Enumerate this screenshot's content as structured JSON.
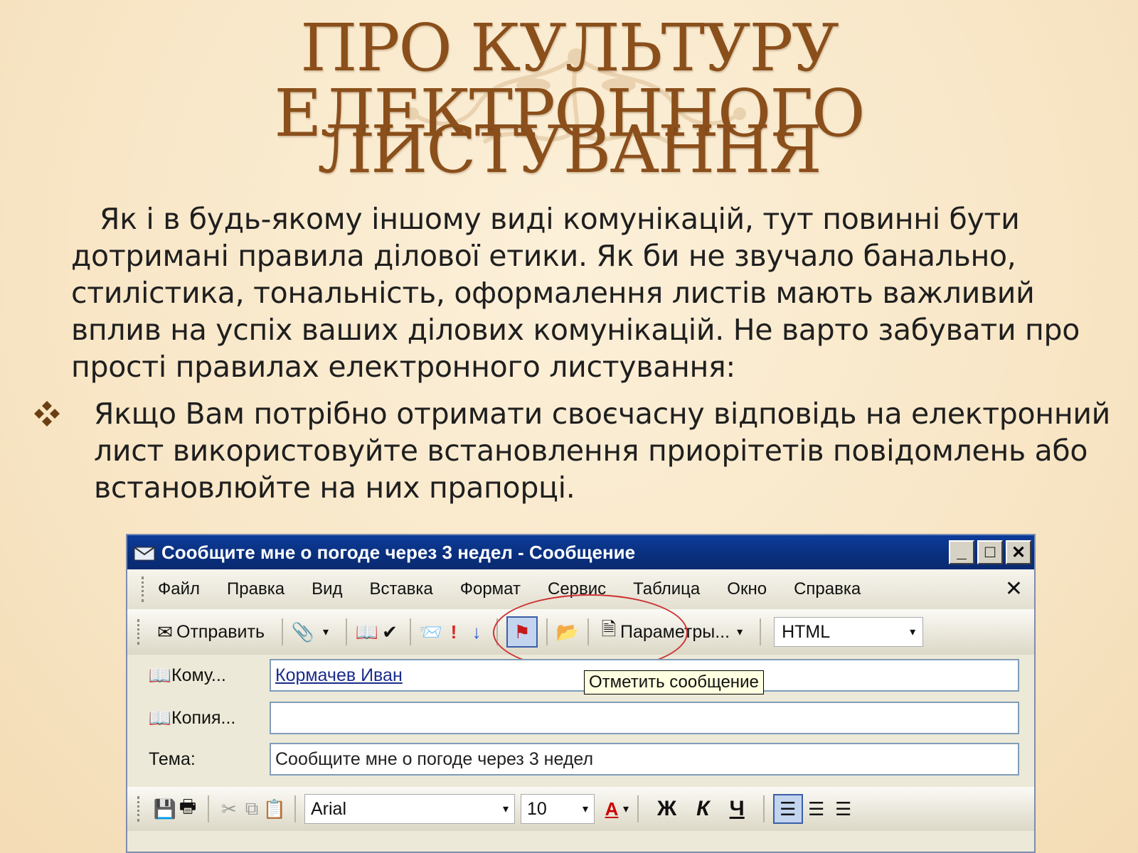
{
  "slide": {
    "title_line1": "ПРО КУЛЬТУРУ ЕЛЕКТРОННОГО",
    "title_line2": "ЛИСТУВАННЯ",
    "paragraph": "Як і в будь-якому іншому виді комунікацій, тут повинні бути дотримані правила ділової етики. Як би не звучало банально, стилістика, тональність, оформалення листів мають важливий вплив на успіх ваших ділових комунікацій. Не варто забувати про прості правилах електронного листування:",
    "bullet": "Якщо Вам потрібно отримати своєчасну відповідь на електронний лист використовуйте встановлення приорітетів повідомлень або встановлюйте на них прапорці.",
    "bullet_icon": "diamond-bullet-icon",
    "title_color": "#8a4f1b"
  },
  "window": {
    "title": "Сообщите мне о погоде через 3 недел - Сообщение",
    "menu": [
      "Файл",
      "Правка",
      "Вид",
      "Вставка",
      "Формат",
      "Сервис",
      "Таблица",
      "Окно",
      "Справка"
    ],
    "toolbar": {
      "send_label": "Отправить",
      "options_label": "Параметры...",
      "format_value": "HTML"
    },
    "tooltip": "Отметить сообщение",
    "to_label": "Кому...",
    "to_value": "Кормачев Иван",
    "cc_label": "Копия...",
    "cc_value": "",
    "subject_label": "Тема:",
    "subject_value": "Сообщите мне о погоде через 3 недел",
    "format": {
      "font": "Arial",
      "size": "10",
      "bold": "Ж",
      "italic": "К",
      "underline": "Ч"
    },
    "titlebar_color": "#0a2f7d"
  }
}
